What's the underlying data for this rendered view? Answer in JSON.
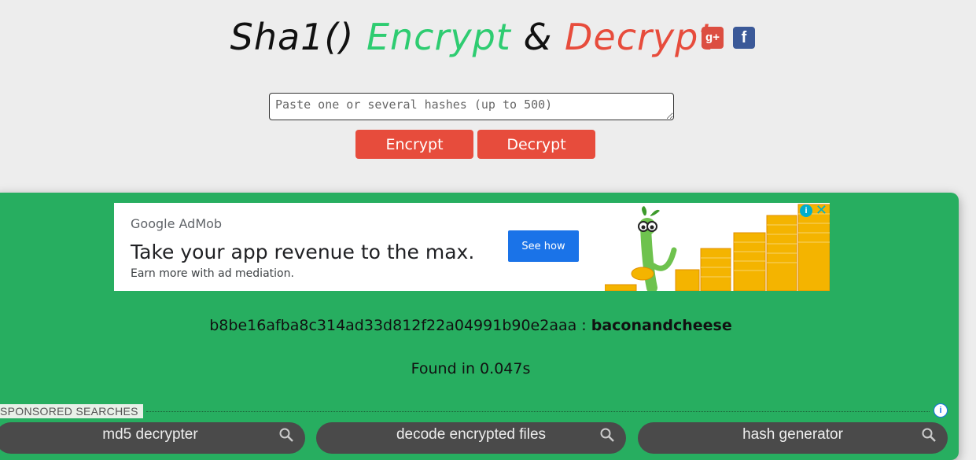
{
  "header": {
    "title_part1": "Sha1()",
    "title_part2": "Encrypt",
    "title_part3": "&",
    "title_part4": "Decrypt",
    "social_gplus": "g+",
    "social_fb": "f"
  },
  "form": {
    "placeholder": "Paste one or several hashes (up to 500)",
    "encrypt_label": "Encrypt",
    "decrypt_label": "Decrypt"
  },
  "ad": {
    "brand_google": "Google",
    "brand_product": "AdMob",
    "headline": "Take your app revenue to the max.",
    "subline": "Earn more with ad mediation.",
    "cta": "See how",
    "info_icon": "info-icon",
    "close_icon": "close-icon"
  },
  "result": {
    "hash": "b8be16afba8c314ad33d812f22a04991b90e2aaa",
    "separator": " : ",
    "plaintext": "baconandcheese",
    "found_text": "Found in 0.047s"
  },
  "sponsored": {
    "label": "SPONSORED SEARCHES",
    "searches": [
      "md5 decrypter",
      "decode encrypted files",
      "hash generator"
    ]
  },
  "colors": {
    "accent_red": "#e74c3c",
    "accent_green": "#2ecc71",
    "panel_green": "#27ae60"
  }
}
